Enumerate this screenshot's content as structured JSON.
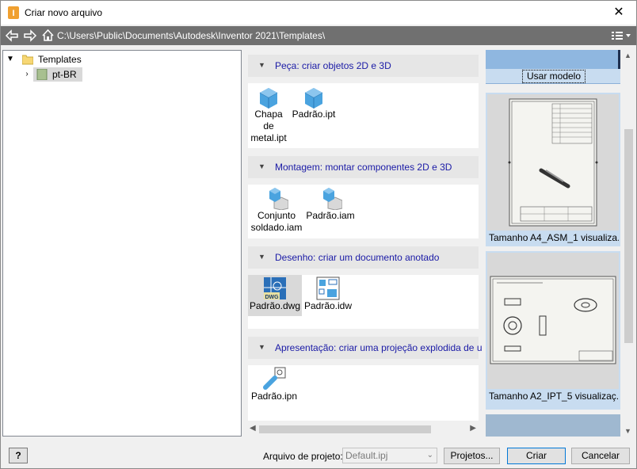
{
  "window": {
    "title": "Criar novo arquivo",
    "close": "✕"
  },
  "address": {
    "path": "C:\\Users\\Public\\Documents\\Autodesk\\Inventor 2021\\Templates\\"
  },
  "tree": {
    "root": "Templates",
    "child": "pt-BR"
  },
  "categories": [
    {
      "label": "Peça: criar objetos 2D e 3D",
      "items": [
        {
          "label": "Chapa de metal.ipt",
          "l1": "Chapa",
          "l2": "de",
          "l3": "metal.ipt"
        },
        {
          "label": "Padrão.ipt"
        }
      ]
    },
    {
      "label": "Montagem: montar componentes 2D e 3D",
      "items": [
        {
          "label": "Conjunto soldado.iam",
          "l1": "Conjunto",
          "l2": "soldado.iam"
        },
        {
          "label": "Padrão.iam"
        }
      ]
    },
    {
      "label": "Desenho: criar um documento anotado",
      "items": [
        {
          "label": "Padrão.dwg",
          "badge": "DWG"
        },
        {
          "label": "Padrão.idw"
        }
      ]
    },
    {
      "label": "Apresentação: criar uma projeção explodida de uma m",
      "items": [
        {
          "label": "Padrão.ipn"
        }
      ]
    }
  ],
  "preview": {
    "use_model": "Usar modelo",
    "thumbnails": [
      {
        "caption": "Tamanho A4_ASM_1 visualiza..."
      },
      {
        "caption": "Tamanho A2_IPT_5 visualizaç..."
      }
    ]
  },
  "bottom": {
    "help": "?",
    "project_label": "Arquivo de projeto:",
    "project_value": "Default.ipj",
    "projects_btn": "Projetos...",
    "create_btn": "Criar",
    "cancel_btn": "Cancelar"
  },
  "colors": {
    "category_text": "#1a1aa6",
    "address_bg": "#707070",
    "selection": "#d9d9d9",
    "preview_bg": "#c8dcf0",
    "primary_border": "#0078d7",
    "part_icon": "#4aa3df"
  }
}
